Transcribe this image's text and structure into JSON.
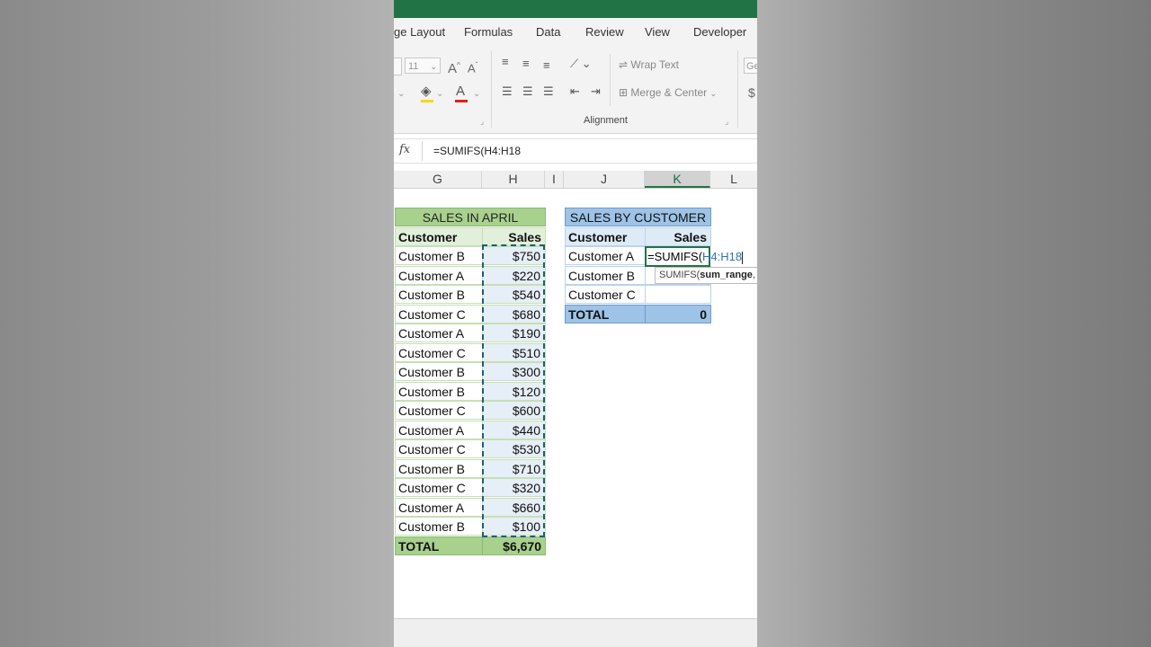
{
  "ribbon_tabs": [
    "ge Layout",
    "Formulas",
    "Data",
    "Review",
    "View",
    "Developer"
  ],
  "font_size_value": "11",
  "font_name_value": "Ge",
  "wrap_text_label": "Wrap Text",
  "merge_center_label": "Merge & Center",
  "alignment_group_label": "Alignment",
  "number_partial": "$",
  "formula_bar": {
    "fx": "fx",
    "text": "=SUMIFS(H4:H18"
  },
  "columns": [
    "G",
    "H",
    "I",
    "J",
    "K",
    "L"
  ],
  "sales_in_april": {
    "title": "SALES IN APRIL",
    "header_customer": "Customer",
    "header_sales": "Sales",
    "rows": [
      {
        "customer": "Customer B",
        "sales": "$750"
      },
      {
        "customer": "Customer A",
        "sales": "$220"
      },
      {
        "customer": "Customer B",
        "sales": "$540"
      },
      {
        "customer": "Customer C",
        "sales": "$680"
      },
      {
        "customer": "Customer A",
        "sales": "$190"
      },
      {
        "customer": "Customer C",
        "sales": "$510"
      },
      {
        "customer": "Customer B",
        "sales": "$300"
      },
      {
        "customer": "Customer B",
        "sales": "$120"
      },
      {
        "customer": "Customer C",
        "sales": "$600"
      },
      {
        "customer": "Customer A",
        "sales": "$440"
      },
      {
        "customer": "Customer C",
        "sales": "$530"
      },
      {
        "customer": "Customer B",
        "sales": "$710"
      },
      {
        "customer": "Customer C",
        "sales": "$320"
      },
      {
        "customer": "Customer A",
        "sales": "$660"
      },
      {
        "customer": "Customer B",
        "sales": "$100"
      }
    ],
    "total_label": "TOTAL",
    "total_value": "$6,670"
  },
  "sales_by_customer": {
    "title": "SALES BY CUSTOMER",
    "header_customer": "Customer",
    "header_sales": "Sales",
    "rows": [
      {
        "customer": "Customer A"
      },
      {
        "customer": "Customer B"
      },
      {
        "customer": "Customer C"
      }
    ],
    "total_label": "TOTAL",
    "total_value": "0",
    "editing_prefix": "=SUMIFS(",
    "editing_ref": "H4:H18",
    "tooltip_func": "SUMIFS(",
    "tooltip_arg": "sum_range",
    "tooltip_rest": ", c"
  },
  "colors": {
    "excel_green": "#217346",
    "green_title": "#a9d18e",
    "blue_title": "#9dc3e6",
    "ref_blue": "#2e74b5"
  }
}
